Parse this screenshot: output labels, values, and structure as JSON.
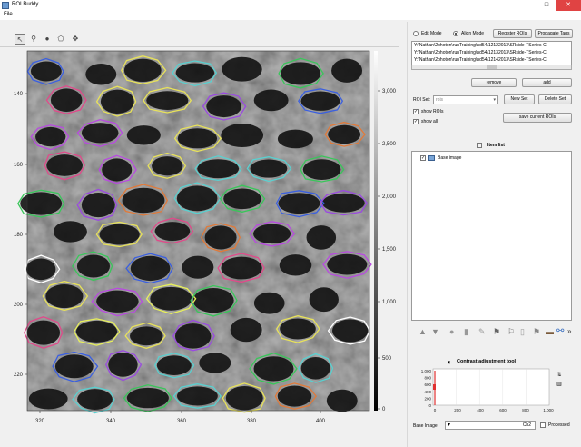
{
  "window": {
    "title": "ROI Buddy",
    "minimize": "–",
    "maximize": "□",
    "close": "✕"
  },
  "menu": {
    "file": "File"
  },
  "toolbar": {
    "tools": [
      "pointer",
      "zoom",
      "circle",
      "polygon",
      "move"
    ]
  },
  "mode": {
    "edit_label": "Edit Mode",
    "align_label": "Align Mode",
    "selected": "Align Mode"
  },
  "buttons": {
    "register_rois": "Register ROIs",
    "propagate_tags": "Propagate Tags",
    "remove": "remove",
    "add": "add",
    "new_set": "New Set",
    "delete_set": "Delete Set",
    "save_current_rois": "save current ROIs"
  },
  "datasets": [
    "Y:\\Nathan\\2photon\\runTraining\\nd54\\12122013\\SRside-TSeries-C",
    "Y:\\Nathan\\2photon\\runTraining\\nd54\\12132013\\SRside-TSeries-C",
    "Y:\\Nathan\\2photon\\runTraining\\nd54\\12142013\\SRside-TSeries-C"
  ],
  "roi_set": {
    "label": "ROI Set:",
    "value": "rois"
  },
  "options": {
    "show_rois": "show ROIs",
    "show_all": "show all"
  },
  "item_list": {
    "header": "Item list",
    "items": [
      {
        "label": "Base image",
        "checked": true
      }
    ]
  },
  "contrast": {
    "title": "Contrast adjustment tool",
    "y_ticks": [
      "1,000",
      "800",
      "600",
      "400",
      "200",
      "0"
    ],
    "x_ticks": [
      "0",
      "200",
      "400",
      "600",
      "800",
      "1,000"
    ]
  },
  "base_image": {
    "label": "Base Image:",
    "value": "Ch2",
    "processed_label": "Processed"
  },
  "image_axes": {
    "x_ticks": [
      "320",
      "340",
      "360",
      "380",
      "400"
    ],
    "y_ticks": [
      "140",
      "160",
      "180",
      "200",
      "220"
    ],
    "colorbar_ticks": [
      "3,000",
      "2,500",
      "2,000",
      "1,500",
      "1,000",
      "500",
      "0"
    ]
  },
  "colors": {
    "accent": "#3a6fc0",
    "roi_palette": [
      "#39c65a",
      "#e8e25a",
      "#b84ae0",
      "#e07a3a",
      "#5ad0d0",
      "#3a5fe0",
      "#e04a8a",
      "#9a4ae0",
      "#e8f05a",
      "#ffffff"
    ]
  }
}
